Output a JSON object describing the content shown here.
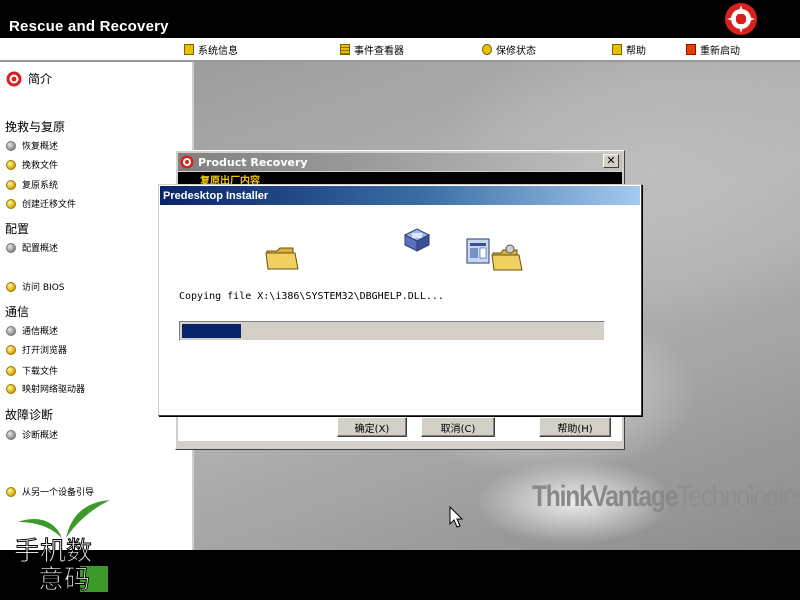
{
  "app": {
    "title": "Rescue and Recovery"
  },
  "menubar": {
    "items": [
      {
        "label": "系统信息",
        "icon": "info-icon"
      },
      {
        "label": "事件查看器",
        "icon": "event-viewer-icon"
      },
      {
        "label": "保修状态",
        "icon": "warranty-icon"
      },
      {
        "label": "帮助",
        "icon": "help-icon"
      },
      {
        "label": "重新启动",
        "icon": "restart-icon"
      }
    ]
  },
  "sidebar": {
    "intro": "简介",
    "sections": [
      {
        "heading": "挽救与复原",
        "items": [
          {
            "label": "恢复概述",
            "icon": "gray"
          },
          {
            "label": "挽救文件",
            "icon": "yellow"
          },
          {
            "label": "复原系统",
            "icon": "yellow"
          },
          {
            "label": "创建迁移文件",
            "icon": "yellow"
          }
        ]
      },
      {
        "heading": "配置",
        "items": [
          {
            "label": "配置概述",
            "icon": "gray"
          },
          {
            "label": "访问 BIOS",
            "icon": "yellow"
          }
        ]
      },
      {
        "heading": "通信",
        "items": [
          {
            "label": "通信概述",
            "icon": "gray"
          },
          {
            "label": "打开浏览器",
            "icon": "yellow"
          },
          {
            "label": "下载文件",
            "icon": "yellow"
          },
          {
            "label": "映射网络驱动器",
            "icon": "yellow"
          }
        ]
      },
      {
        "heading": "故障诊断",
        "items": [
          {
            "label": "诊断概述",
            "icon": "gray"
          }
        ]
      }
    ],
    "boot_other": "从另一个设备引导"
  },
  "brand": {
    "think": "ThinkVantage",
    "tech": "Technologies"
  },
  "watermark": {
    "text1": "手机数",
    "text2": "意码",
    "mark": "®"
  },
  "product_recovery": {
    "title": "Product Recovery",
    "subtitle": "复原出厂内容",
    "close": "✕",
    "buttons": {
      "ok": "确定(X)",
      "cancel": "取消(C)",
      "help": "帮助(H)"
    }
  },
  "installer": {
    "title": "Predesktop Installer",
    "status": "Copying file X:\\i386\\SYSTEM32\\DBGHELP.DLL...",
    "progress_fraction": 0.14
  }
}
